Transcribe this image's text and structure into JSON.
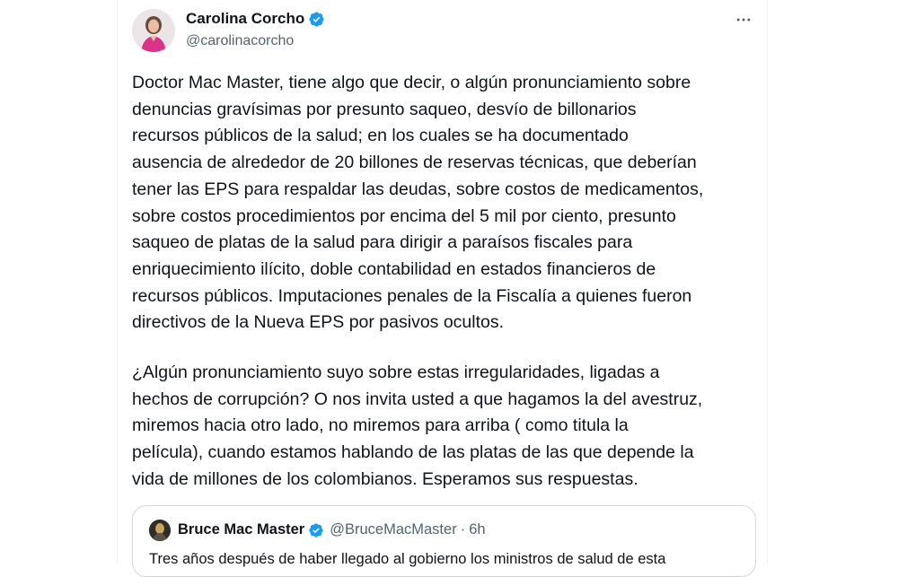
{
  "tweet": {
    "author": {
      "display_name": "Carolina Corcho",
      "handle": "@carolinacorcho",
      "verified": true
    },
    "more_icon": "more-options-icon",
    "paragraph1": "Doctor Mac Master, tiene algo que decir, o algún pronunciamiento sobre\ndenuncias gravísimas por presunto saqueo, desvío de billonarios\nrecursos públicos de la salud; en los cuales se ha documentado\nausencia de alrededor de 20 billones de reservas técnicas, que deberían\ntener las EPS para respaldar las deudas, sobre costos de medicamentos,\nsobre costos procedimientos por encima del 5 mil por ciento, presunto\nsaqueo de platas de la salud para dirigir a paraísos fiscales para\nenriquecimiento ilícito, doble contabilidad en estados financieros de\nrecursos públicos. Imputaciones penales de la Fiscalía a quienes fueron\ndirectivos de la Nueva EPS por pasivos ocultos.",
    "paragraph2": "¿Algún pronunciamiento suyo sobre estas irregularidades, ligadas a\nhechos de corrupción? O nos invita usted a que hagamos la del avestruz,\nmiremos hacia otro lado, no miremos para arriba ( como titula la\npelícula), cuando estamos hablando de las platas de las que depende la\nvida de millones de los colombianos. Esperamos sus respuestas."
  },
  "quoted_tweet": {
    "display_name": "Bruce Mac Master",
    "handle": "@BruceMacMaster",
    "separator": "·",
    "time": "6h",
    "verified": true,
    "text": "Tres años después de haber llegado al gobierno los ministros de salud de esta"
  },
  "colors": {
    "verified_blue": "#1d9bf0",
    "secondary_text": "#536471",
    "primary_text": "#0f1419",
    "border": "#cfd9de"
  }
}
